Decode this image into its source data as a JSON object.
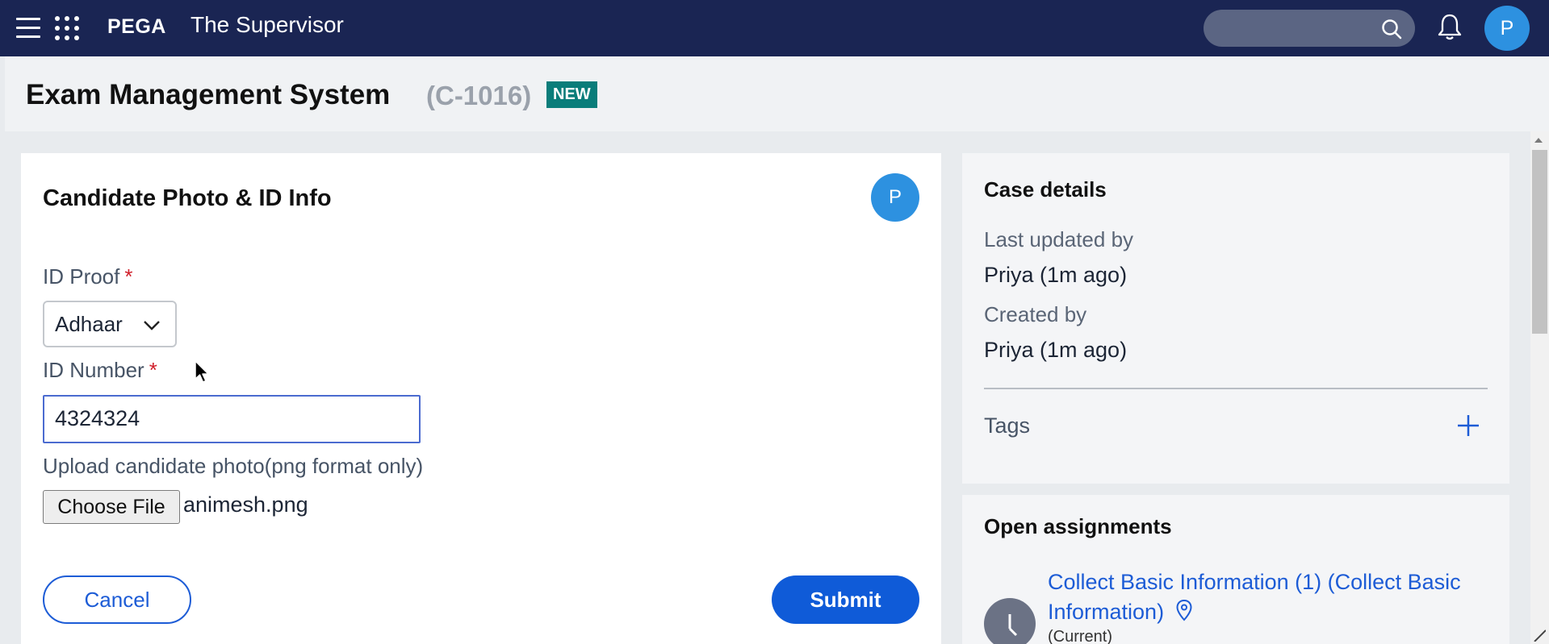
{
  "header": {
    "brand": "PEGA",
    "app_title": "The Supervisor",
    "user_initial": "P"
  },
  "case": {
    "title": "Exam Management System",
    "id": "(C-1016)",
    "status": "NEW"
  },
  "form": {
    "section_title": "Candidate Photo & ID Info",
    "assignee_initial": "P",
    "id_proof_label": "ID Proof",
    "id_proof_value": "Adhaar",
    "id_number_label": "ID Number",
    "id_number_value": "4324324",
    "required_mark": "*",
    "upload_label": "Upload candidate photo(png format only)",
    "choose_file_label": "Choose File",
    "file_name": "animesh.png",
    "cancel_label": "Cancel",
    "submit_label": "Submit"
  },
  "case_details": {
    "title": "Case details",
    "last_updated_label": "Last updated by",
    "last_updated_value": "Priya (1m ago)",
    "created_label": "Created by",
    "created_value": "Priya (1m ago)",
    "tags_label": "Tags"
  },
  "assignments": {
    "title": "Open assignments",
    "item_label": "Collect Basic Information (1) (Collect Basic Information)",
    "item_status": "(Current)"
  },
  "colors": {
    "header_bg": "#1a2553",
    "accent": "#0f5bd8",
    "badge": "#0a7d7a",
    "avatar": "#2d91e0"
  }
}
